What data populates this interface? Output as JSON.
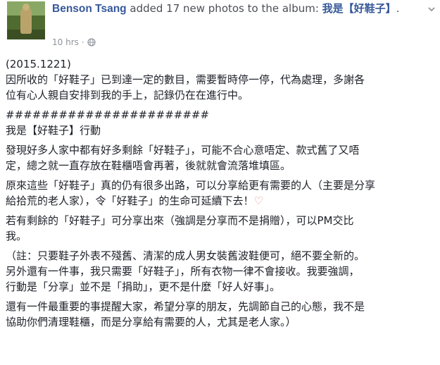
{
  "header": {
    "author": "Benson Tsang",
    "action": " added 17 new photos to the album: ",
    "album": "我是【好鞋子】",
    "album_suffix": ".",
    "timestamp": "10 hrs",
    "separator": "·",
    "privacy_icon": "globe-icon",
    "menu_icon": "chevron-down-icon"
  },
  "body": {
    "date": "(2015.1221)",
    "notice": "因所收的「好鞋子」已到達一定的數目，需要暫時停一停，代為處理，多謝各\n位有心人親自安排到我的手上，記錄仍在在進行中。",
    "divider": "#######################",
    "title": "我是【好鞋子】行動",
    "para1": "發現好多人家中都有好多剩餘「好鞋子」，可能不合心意唔定、款式舊了又唔\n定，總之就一直存放在鞋櫃唔會再著，後就就會流落堆填區。",
    "para2": "原來這些「好鞋子」真的仍有很多出路，可以分享給更有需要的人（主要是分享\n給拾荒的老人家），令「好鞋子」的生命可延續下去！",
    "para2_emoji": "♡",
    "para3": "若有剩餘的「好鞋子」可分享出來（強調是分享而不是捐贈），可以PM交比\n我。",
    "para4": "（註：只要鞋子外表不殘舊、清潔的成人男女裝舊波鞋便可，絕不要全新的。\n另外還有一件事，我只需要「好鞋子」，所有衣物一律不會接收。我要強調，\n行動是「分享」並不是「捐助」，更不是什麼「好人好事」。",
    "para5": "還有一件最重要的事提醒大家，希望分享的朋友，先調節自己的心態，我不是\n協助你們清理鞋櫃，而是分享給有需要的人，尤其是老人家。）"
  },
  "colors": {
    "link": "#365899",
    "meta": "#90949c",
    "text": "#1d2129",
    "heart": "#f08e8e"
  }
}
